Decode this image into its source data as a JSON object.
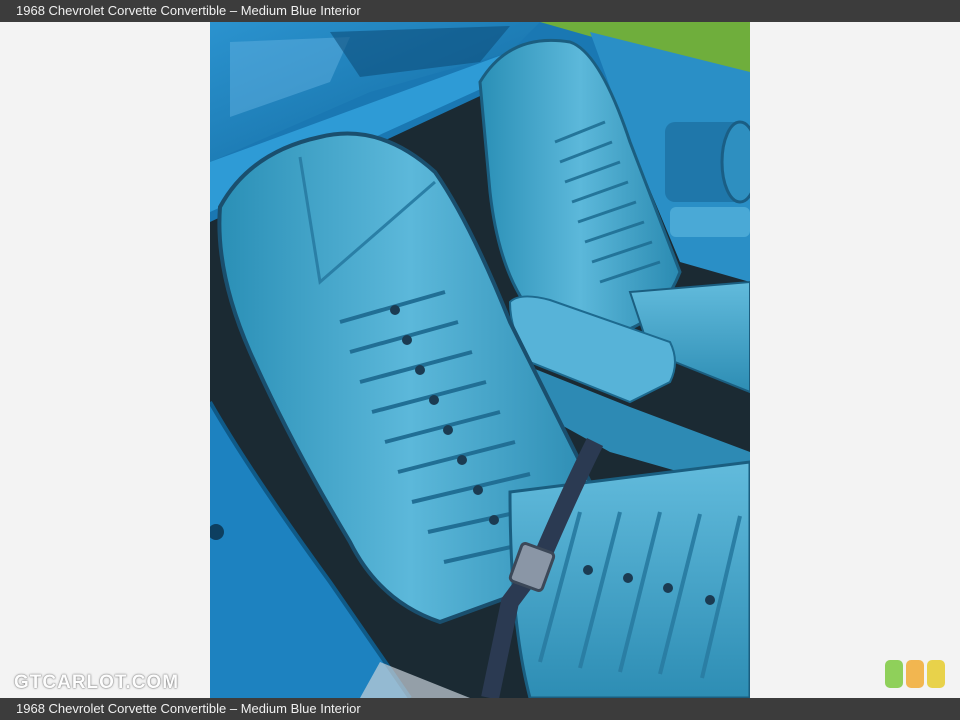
{
  "caption": "1968 Chevrolet Corvette Convertible – Medium Blue Interior",
  "watermark": "GTCARLOT.COM",
  "photo": {
    "subject": "car-interior-photo",
    "colors": {
      "seat": "#3a9fc4",
      "seat_highlight": "#7cc7e2",
      "seat_shadow": "#1d6c8f",
      "body_paint": "#1d82c0",
      "carpet": "#1b2a33",
      "grass": "#6fae3c",
      "belt": "#2b3a52"
    }
  },
  "logo": {
    "icon": "three-rounded-squares-logo-icon",
    "colors": [
      "#8fd05a",
      "#f2b650",
      "#e8d24a"
    ]
  }
}
